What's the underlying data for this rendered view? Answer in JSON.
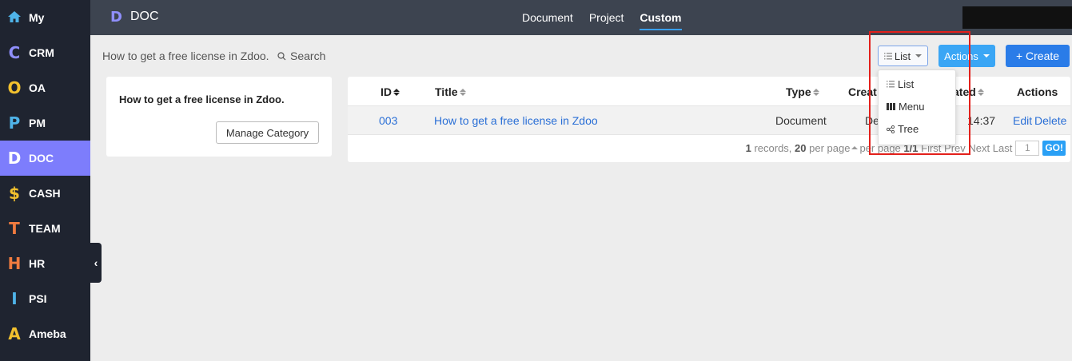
{
  "sidebar": {
    "items": [
      {
        "icon": "home-icon",
        "letter": "⌂",
        "color": "#4fb3e8",
        "label": "My"
      },
      {
        "icon": "crm-icon",
        "letter": "C",
        "color": "#8f8ffc",
        "label": "CRM"
      },
      {
        "icon": "oa-icon",
        "letter": "O",
        "color": "#f2c12e",
        "label": "OA"
      },
      {
        "icon": "pm-icon",
        "letter": "P",
        "color": "#4fb3e8",
        "label": "PM"
      },
      {
        "icon": "doc-icon",
        "letter": "D",
        "color": "#ffffff",
        "label": "DOC"
      },
      {
        "icon": "cash-icon",
        "letter": "$",
        "color": "#f2c12e",
        "label": "CASH"
      },
      {
        "icon": "team-icon",
        "letter": "T",
        "color": "#f07b3f",
        "label": "TEAM"
      },
      {
        "icon": "hr-icon",
        "letter": "H",
        "color": "#f07b3f",
        "label": "HR"
      },
      {
        "icon": "psi-icon",
        "letter": "I",
        "color": "#4fb3e8",
        "label": "PSI"
      },
      {
        "icon": "ameba-icon",
        "letter": "A",
        "color": "#f2c12e",
        "label": "Ameba"
      }
    ],
    "active": "DOC"
  },
  "header": {
    "logo_letter": "D",
    "title": "DOC",
    "tabs": [
      {
        "label": "Document",
        "active": false
      },
      {
        "label": "Project",
        "active": false
      },
      {
        "label": "Custom",
        "active": true
      }
    ]
  },
  "toolbar": {
    "breadcrumb": "How to get a free license in Zdoo.",
    "search_label": "Search",
    "list_label": "List",
    "actions_label": "Actions",
    "create_label": "+ Create"
  },
  "category": {
    "title": "How to get a free license in Zdoo.",
    "manage_label": "Manage Category"
  },
  "table": {
    "headers": {
      "id": "ID",
      "title": "Title",
      "type": "Type",
      "created": "Creat",
      "edited": "ated",
      "actions": "Actions"
    },
    "rows": [
      {
        "id": "003",
        "title": "How to get a free license in Zdoo",
        "type": "Document",
        "created": "De",
        "edited": "14:37",
        "edit": "Edit",
        "delete": "Delete"
      }
    ],
    "pager": {
      "records_count": "1",
      "records_text": "records,",
      "per_page_count": "20",
      "per_page_text": "per page",
      "hidden_per_page": "per page",
      "page_info": "1/1",
      "first": "First",
      "prev": "Prev",
      "next": "Next",
      "last": "Last",
      "page_input": "1",
      "go": "GO!"
    }
  },
  "view_menu": {
    "items": [
      {
        "icon": "list-icon",
        "label": "List"
      },
      {
        "icon": "menu-icon",
        "label": "Menu"
      },
      {
        "icon": "tree-icon",
        "label": "Tree"
      }
    ]
  },
  "colors": {
    "sidebar_bg": "#1f2430",
    "active_item": "#7d7dfc",
    "topbar_bg": "#3d4450",
    "primary": "#2a7ce8",
    "highlight": "#e3201b"
  }
}
